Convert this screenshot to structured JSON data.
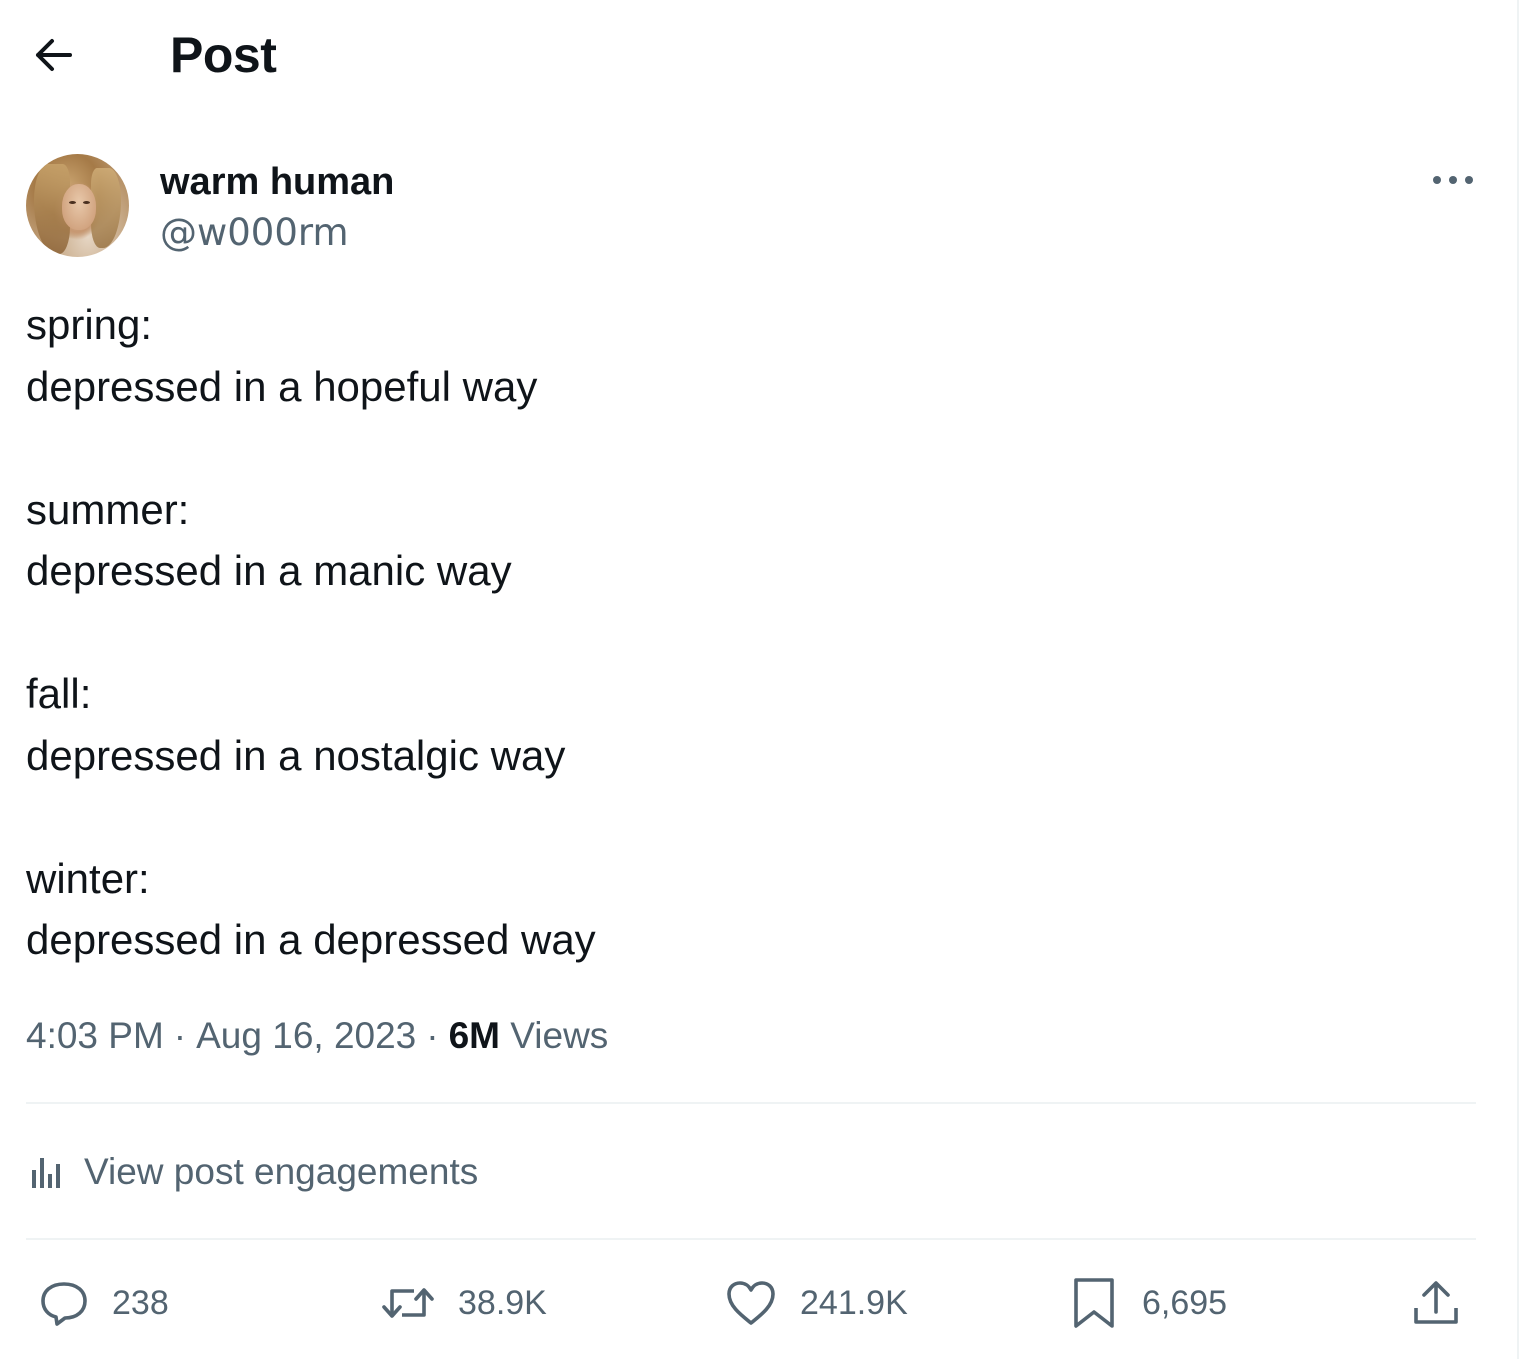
{
  "header": {
    "back_icon": "arrow-left-icon",
    "title": "Post"
  },
  "author": {
    "display_name": "warm human",
    "handle": "@w000rm",
    "avatar_icon": "profile-photo",
    "more_icon": "more-horizontal-icon"
  },
  "post": {
    "lines": [
      "spring:",
      "depressed in a hopeful way",
      "",
      "summer:",
      "depressed in a manic way",
      "",
      "fall:",
      "depressed in a nostalgic way",
      "",
      "winter:",
      "depressed in a depressed way"
    ],
    "time": "4:03 PM",
    "date": "Aug 16, 2023",
    "separator": "·",
    "views_count": "6M",
    "views_label": "Views"
  },
  "engagements": {
    "icon": "analytics-bars-icon",
    "label": "View post engagements"
  },
  "actions": {
    "reply": {
      "icon": "reply-icon",
      "count": "238"
    },
    "repost": {
      "icon": "repost-icon",
      "count": "38.9K"
    },
    "like": {
      "icon": "heart-icon",
      "count": "241.9K"
    },
    "bookmark": {
      "icon": "bookmark-icon",
      "count": "6,695"
    },
    "share": {
      "icon": "share-icon"
    }
  },
  "colors": {
    "text_primary": "#0f1419",
    "text_secondary": "#536471",
    "divider": "#eff3f4"
  }
}
